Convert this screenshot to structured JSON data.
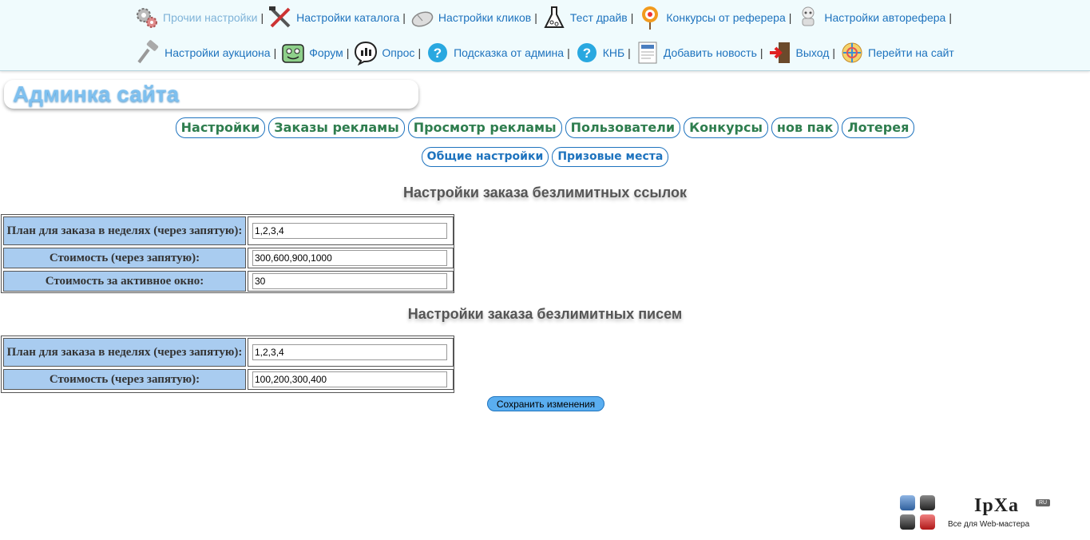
{
  "nav": {
    "row1": [
      {
        "label": "Прочии настройки",
        "icon": "gears-icon"
      },
      {
        "label": "Настройки каталога",
        "icon": "tools-icon"
      },
      {
        "label": "Настройки кликов",
        "icon": "mouse-icon"
      },
      {
        "label": "Тест драйв",
        "icon": "flask-icon"
      },
      {
        "label": "Конкурсы от реферера",
        "icon": "target-icon"
      },
      {
        "label": "Настройки автореферa",
        "icon": "robot-icon"
      }
    ],
    "row2": [
      {
        "label": "Настройки аукциона",
        "icon": "gavel-icon"
      },
      {
        "label": "Форум",
        "icon": "forum-icon"
      },
      {
        "label": "Опрос",
        "icon": "poll-icon"
      },
      {
        "label": "Подсказка от админа",
        "icon": "help-icon"
      },
      {
        "label": "КНБ",
        "icon": "help-icon"
      },
      {
        "label": "Добавить новость",
        "icon": "news-icon"
      },
      {
        "label": "Выход",
        "icon": "exit-icon"
      },
      {
        "label": "Перейти на сайт",
        "icon": "site-icon"
      }
    ],
    "separator": "|"
  },
  "title": "Админка сайта",
  "tabs_main": [
    "Настройки",
    "Заказы рекламы",
    "Просмотр рекламы",
    "Пользователи",
    "Конкурсы",
    "нов пак",
    "Лотерея"
  ],
  "tabs_sub": [
    "Общие настройки",
    "Призовые места"
  ],
  "links_section": {
    "heading": "Настройки заказа безлимитных ссылок",
    "rows": [
      {
        "label": "План для заказа в неделях (через запятую):",
        "value": "1,2,3,4"
      },
      {
        "label": "Стоимость (через запятую):",
        "value": "300,600,900,1000"
      },
      {
        "label": "Стоимость за активное окно:",
        "value": "30"
      }
    ]
  },
  "mail_section": {
    "heading": "Настройки заказа безлимитных писем",
    "rows": [
      {
        "label": "План для заказа в неделях (через запятую):",
        "value": "1,2,3,4"
      },
      {
        "label": "Стоимость (через запятую):",
        "value": "100,200,300,400"
      }
    ]
  },
  "save_label": "Сохранить изменения",
  "logo": {
    "text": "IpXa",
    "badge": "RU",
    "tagline": "Все для Web-мастера"
  }
}
